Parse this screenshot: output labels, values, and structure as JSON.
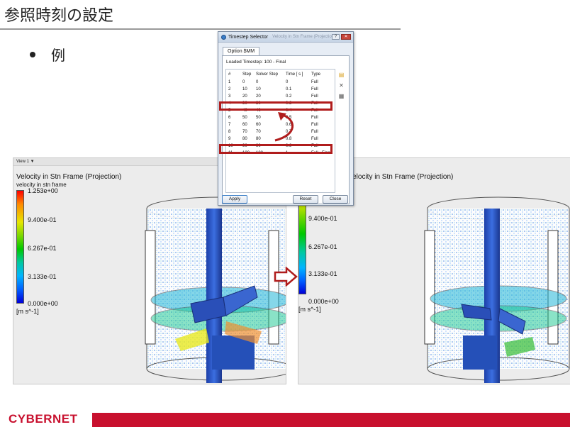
{
  "slide": {
    "title": "参照時刻の設定",
    "bullet": "例"
  },
  "brand": {
    "name": "CYBERNET",
    "color": "#c8102e"
  },
  "viewports": {
    "left": {
      "tab": "View 1 ▼",
      "title": "Velocity in Stn Frame (Projection)",
      "subtitle": "velocity in stn frame",
      "legend": [
        "1.253e+00",
        "9.400e-01",
        "6.267e-01",
        "3.133e-01",
        "0.000e+00"
      ],
      "unit": "[m s^-1]"
    },
    "right": {
      "title": "Velocity in Stn Frame (Projection)",
      "legend": [
        "9.400e-01",
        "6.267e-01",
        "3.133e-01",
        "0.000e+00"
      ],
      "unit": "[m s^-1]"
    }
  },
  "dialog": {
    "title": "Timestep Selector",
    "ghost_title": "Velocity in Stn Frame (Projection)",
    "tab": "Option $MM",
    "loaded": "Loaded Timestep:  100 - Final",
    "columns": [
      "#",
      "Step",
      "Solver Step",
      "Time [ s ]",
      "Type"
    ],
    "rows": [
      [
        "1",
        "0",
        "0",
        "0",
        "Full"
      ],
      [
        "2",
        "10",
        "10",
        "0.1",
        "Full"
      ],
      [
        "3",
        "20",
        "20",
        "0.2",
        "Full"
      ],
      [
        "4",
        "30",
        "30",
        "0.3",
        "Full"
      ],
      [
        "5",
        "40",
        "40",
        "0.4",
        "Full"
      ],
      [
        "6",
        "50",
        "50",
        "0.5",
        "Full"
      ],
      [
        "7",
        "60",
        "60",
        "0.6",
        "Full"
      ],
      [
        "8",
        "70",
        "70",
        "0.7",
        "Full"
      ],
      [
        "9",
        "80",
        "80",
        "0.8",
        "Full"
      ],
      [
        "10",
        "90",
        "90",
        "0.9",
        "Full"
      ],
      [
        "11",
        "100",
        "100",
        "1",
        "Full - Final"
      ]
    ],
    "buttons": {
      "apply": "Apply",
      "reset": "Reset",
      "close": "Close"
    },
    "highlight_color": "#b01c1c"
  }
}
